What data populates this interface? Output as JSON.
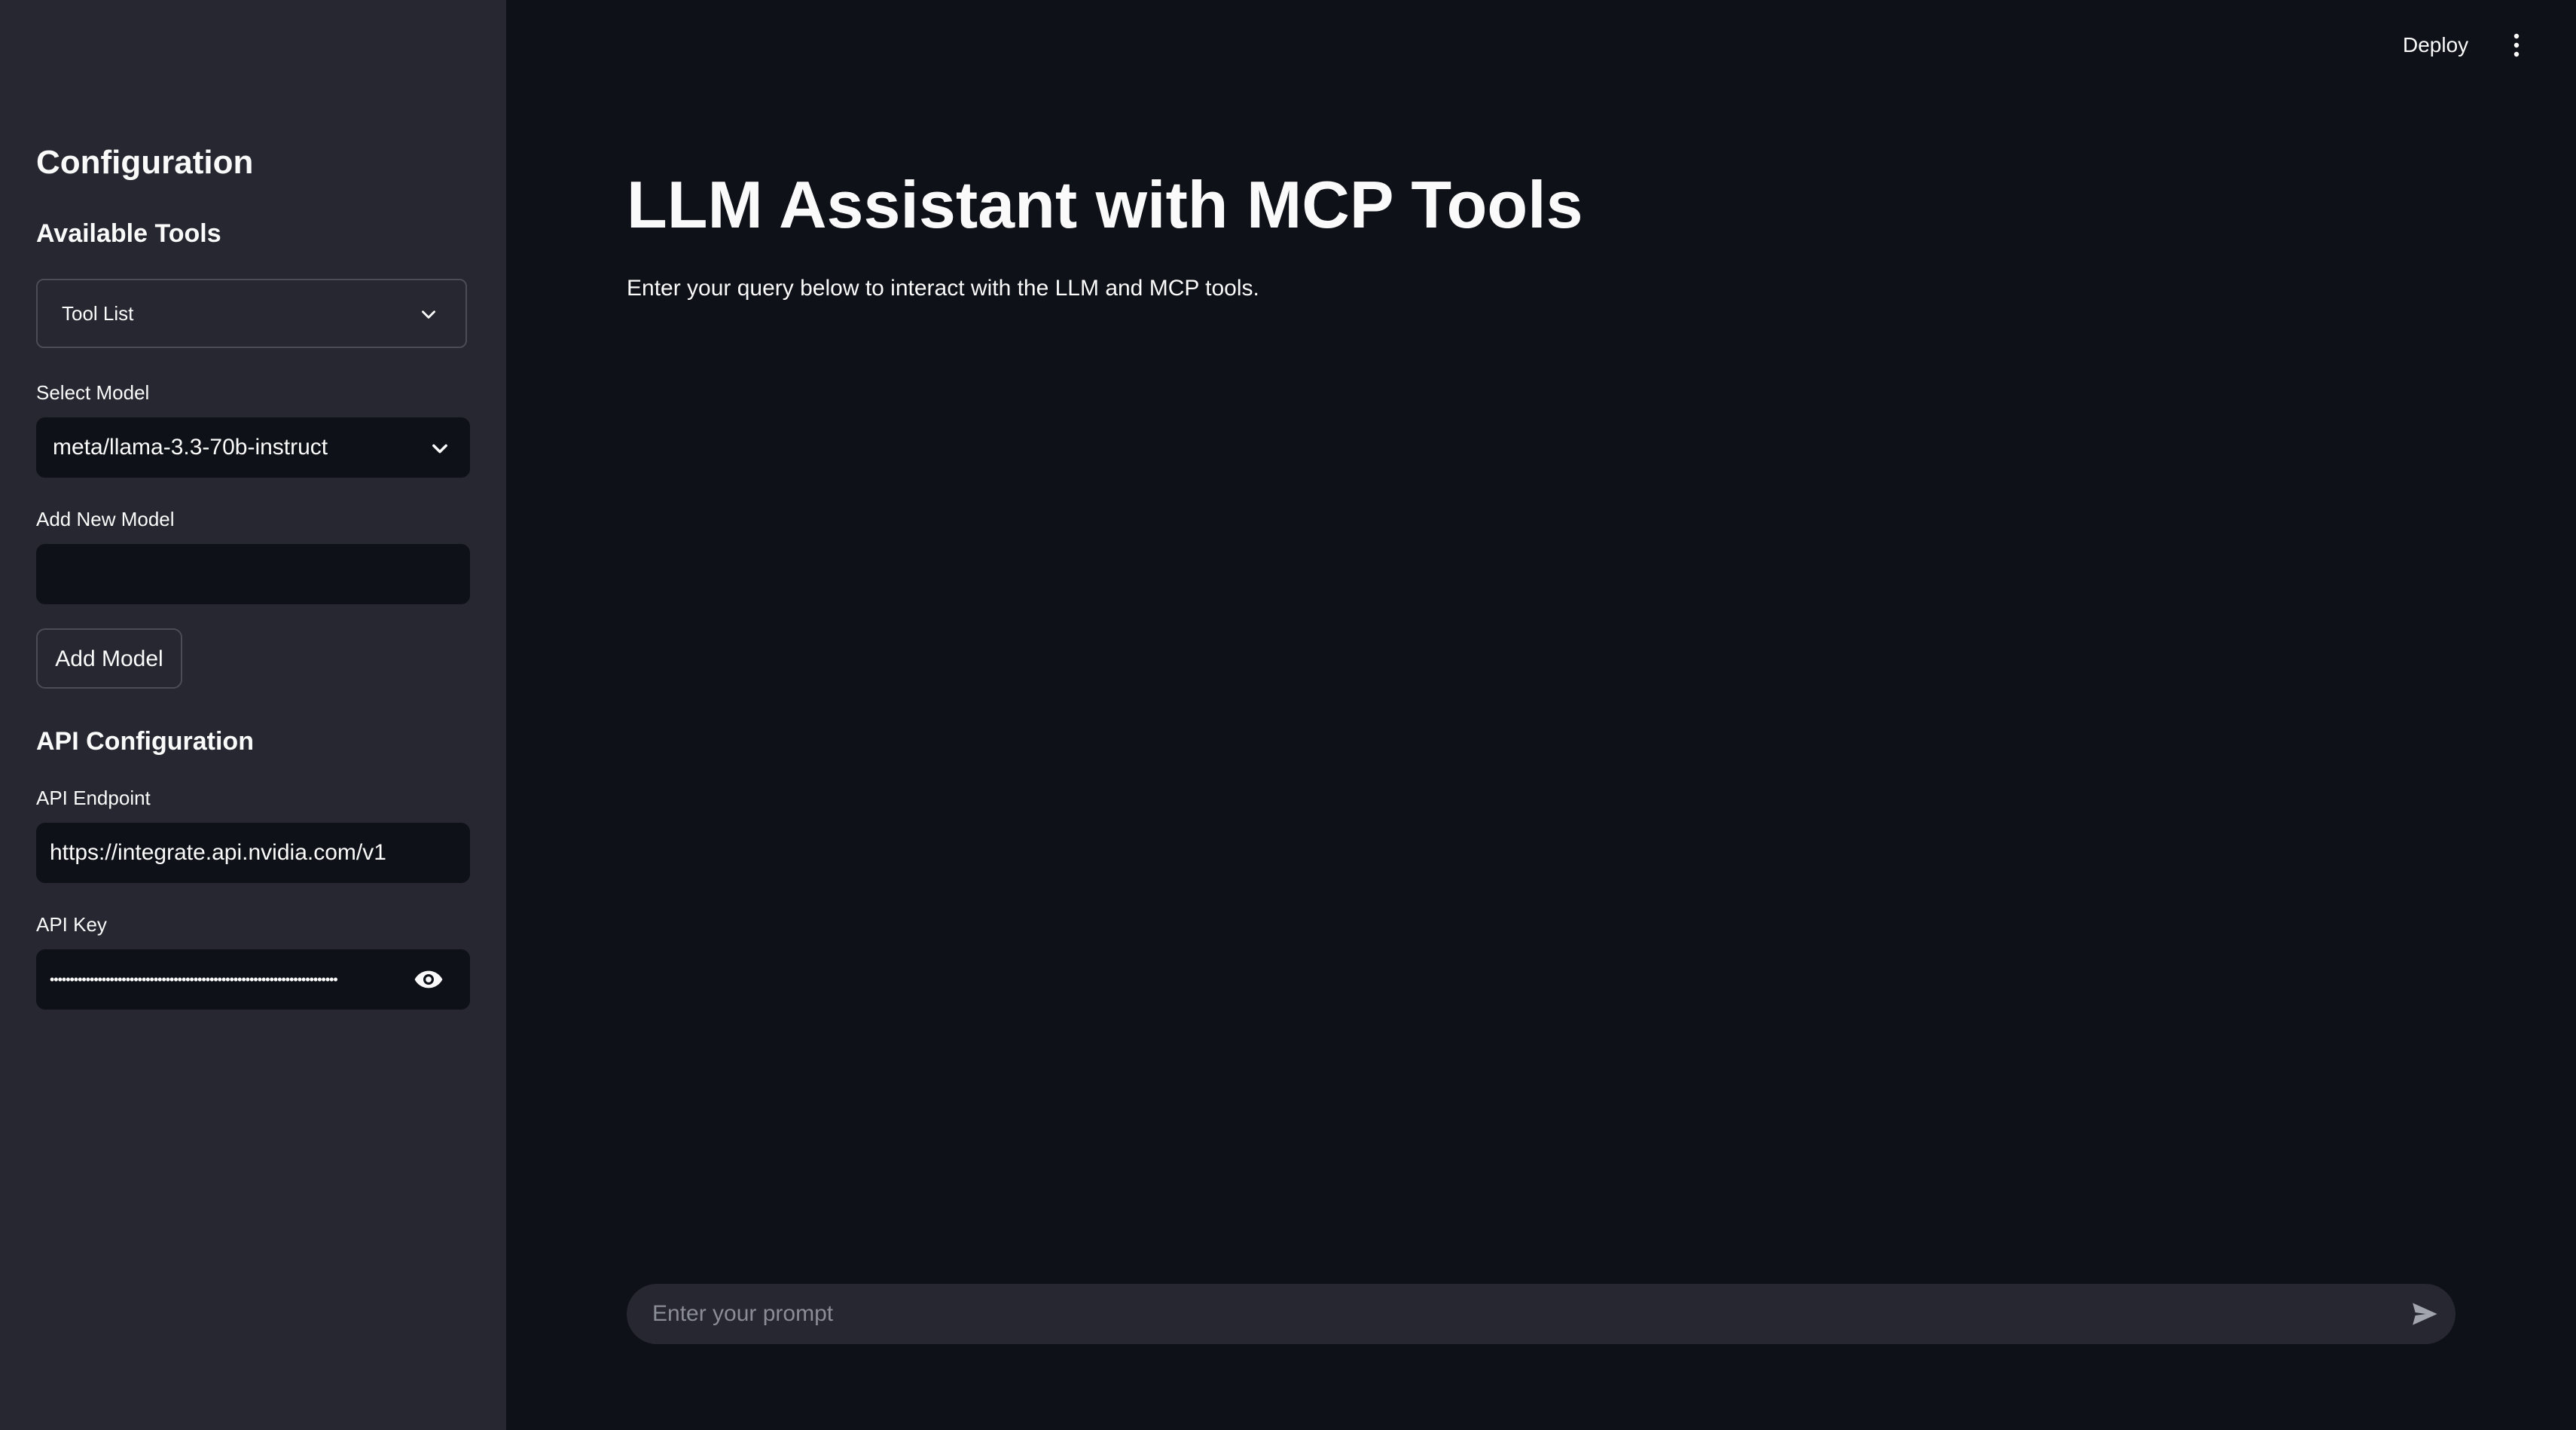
{
  "header": {
    "deploy_label": "Deploy",
    "menu_icon": "kebab-vertical-icon"
  },
  "sidebar": {
    "title": "Configuration",
    "tools_header": "Available Tools",
    "tools_expander_label": "Tool List",
    "select_model_label": "Select Model",
    "selected_model": "meta/llama-3.3-70b-instruct",
    "add_model_label": "Add New Model",
    "add_model_value": "",
    "add_model_button": "Add Model",
    "api_header": "API Configuration",
    "api_endpoint_label": "API Endpoint",
    "api_endpoint_value": "https://integrate.api.nvidia.com/v1",
    "api_key_label": "API Key",
    "api_key_masked": "••••••••••••••••••••••••••••••••••••••••••••••••••••••••••••••••••••••••"
  },
  "main": {
    "title": "LLM Assistant with MCP Tools",
    "caption": "Enter your query below to interact with the LLM and MCP tools.",
    "chat_placeholder": "Enter your prompt"
  },
  "colors": {
    "main_bg": "#0e1117",
    "sidebar_bg": "#262730",
    "text": "#fafafa",
    "border": "#4a4c57",
    "placeholder": "#8a8c96"
  }
}
